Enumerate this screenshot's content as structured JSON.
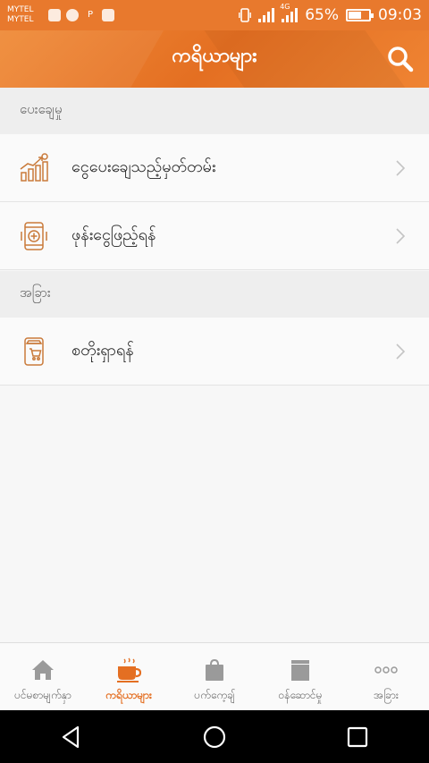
{
  "status_bar": {
    "carrier_1": "MYTEL",
    "carrier_2": "MYTEL",
    "network_type": "4G",
    "battery": "65%",
    "battery_level": 0.65,
    "time": "09:03"
  },
  "header": {
    "title": "ကရိယာများ",
    "search_icon": "search-icon"
  },
  "sections": [
    {
      "title": "ပေးချေမှု",
      "items": [
        {
          "label": "ငွေပေးချေသည့်မှတ်တမ်း",
          "icon": "payment-history-icon"
        },
        {
          "label": "ဖုန်းငွေဖြည့်ရန်",
          "icon": "phone-topup-icon"
        }
      ]
    },
    {
      "title": "အခြား",
      "items": [
        {
          "label": "စတိုးရှာရန်",
          "icon": "store-icon"
        }
      ]
    }
  ],
  "bottom_nav": {
    "items": [
      {
        "label": "ပင်မစာမျက်နှာ",
        "icon": "home-icon"
      },
      {
        "label": "ကရိယာများ",
        "icon": "coffee-cup-icon",
        "active": true
      },
      {
        "label": "ပက်ကေ့ချ်",
        "icon": "package-bag-icon"
      },
      {
        "label": "ဝန်ဆောင်မှု",
        "icon": "service-box-icon"
      },
      {
        "label": "အခြား",
        "icon": "more-dots-icon"
      }
    ]
  },
  "colors": {
    "accent": "#e46f22",
    "status_bar": "#e8792d",
    "icon_line": "#c97a3a"
  }
}
